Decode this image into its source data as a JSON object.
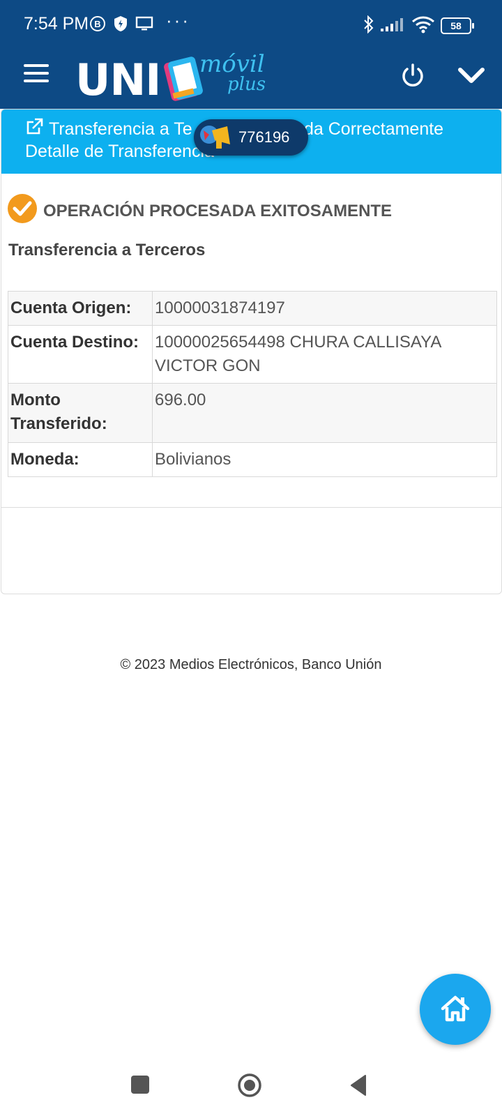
{
  "status_bar": {
    "time": "7:54 PM",
    "battery": "58"
  },
  "header": {
    "logo_uni": "UNI",
    "logo_movil": "móvil",
    "logo_plus": "plus"
  },
  "banner": {
    "line1_left": "Transferencia a Te",
    "line1_right": "letada Correctamente",
    "line2": "Detalle de Transferencia",
    "overlay_number": "776196"
  },
  "result": {
    "status_message": "OPERACIÓN PROCESADA EXITOSAMENTE",
    "subtitle": "Transferencia a Terceros",
    "rows": [
      {
        "label": "Cuenta Origen:",
        "value": "10000031874197"
      },
      {
        "label": "Cuenta Destino:",
        "value": "10000025654498 CHURA CALLISAYA VICTOR GON"
      },
      {
        "label": "Monto Transferido:",
        "value": "696.00"
      },
      {
        "label": "Moneda:",
        "value": "Bolivianos"
      }
    ]
  },
  "footer": {
    "copyright": "© 2023 Medios Electrónicos, Banco Unión"
  },
  "colors": {
    "header_bg": "#0d4a85",
    "banner_bg": "#0db0ef",
    "success_orange": "#f29a1d",
    "fab_blue": "#1ba7ee"
  },
  "icons": [
    "menu-icon",
    "power-icon",
    "chevron-down-icon",
    "external-link-icon",
    "check-circle-icon",
    "home-icon"
  ]
}
